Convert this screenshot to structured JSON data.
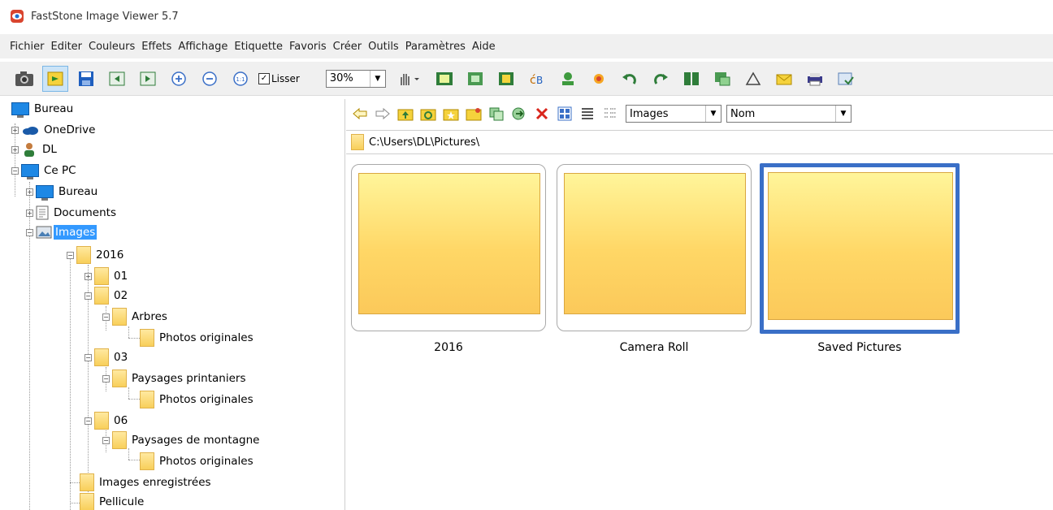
{
  "window": {
    "title": "FastStone Image Viewer 5.7",
    "icon": "app-eye-icon"
  },
  "menu": [
    "Fichier",
    "Editer",
    "Couleurs",
    "Effets",
    "Affichage",
    "Etiquette",
    "Favoris",
    "Créer",
    "Outils",
    "Paramètres",
    "Aide"
  ],
  "toolbar": {
    "smooth_label": "Lisser",
    "smooth_checked": true,
    "zoom_value": "30%"
  },
  "tree": [
    {
      "label": "Bureau",
      "icon": "desktop-icon"
    },
    {
      "label": "OneDrive",
      "icon": "cloud-icon"
    },
    {
      "label": "DL",
      "icon": "user-icon"
    },
    {
      "label": "Ce PC",
      "icon": "pc-icon"
    },
    {
      "label": "Bureau",
      "icon": "desktop-icon"
    },
    {
      "label": "Documents",
      "icon": "documents-icon"
    },
    {
      "label": "Images",
      "icon": "images-icon",
      "selected": true
    },
    {
      "label": "2016",
      "icon": "folder-icon"
    },
    {
      "label": "01",
      "icon": "folder-icon"
    },
    {
      "label": "02",
      "icon": "folder-icon"
    },
    {
      "label": "Arbres",
      "icon": "folder-icon"
    },
    {
      "label": "Photos originales",
      "icon": "folder-icon"
    },
    {
      "label": "03",
      "icon": "folder-icon"
    },
    {
      "label": "Paysages printaniers",
      "icon": "folder-icon"
    },
    {
      "label": "Photos originales",
      "icon": "folder-icon"
    },
    {
      "label": "06",
      "icon": "folder-icon"
    },
    {
      "label": "Paysages de montagne",
      "icon": "folder-icon"
    },
    {
      "label": "Photos originales",
      "icon": "folder-icon"
    },
    {
      "label": "Images enregistrées",
      "icon": "folder-icon"
    },
    {
      "label": "Pellicule",
      "icon": "folder-icon"
    }
  ],
  "browser": {
    "filter_value": "Images",
    "sort_value": "Nom",
    "path": "C:\\Users\\DL\\Pictures\\"
  },
  "thumbnails": [
    {
      "label": "2016"
    },
    {
      "label": "Camera Roll"
    },
    {
      "label": "Saved Pictures",
      "selected": true
    }
  ],
  "colors": {
    "selection_blue": "#3a6fc7",
    "tree_selection": "#3399ff",
    "folder_yellow": "#ffd766"
  }
}
